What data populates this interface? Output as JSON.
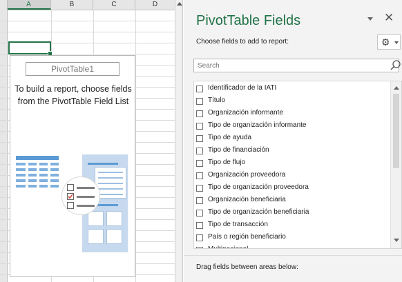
{
  "sheet": {
    "columns": [
      "A",
      "B",
      "C",
      "D"
    ],
    "pivot": {
      "name": "PivotTable1",
      "instructions": "To build a report, choose fields from the PivotTable Field List"
    }
  },
  "pane": {
    "title": "PivotTable Fields",
    "choose_label": "Choose fields to add to report:",
    "search_placeholder": "Search",
    "fields": [
      "Identificador de la IATI",
      "Título",
      "Organización informante",
      "Tipo de organización informante",
      "Tipo de ayuda",
      "Tipo de financiación",
      "Tipo de flujo",
      "Organización proveedora",
      "Tipo de organización proveedora",
      "Organización beneficiaria",
      "Tipo de organización beneficiaria",
      "Tipo de transacción",
      "País o región beneficiario",
      "Multinacional"
    ],
    "drag_label": "Drag fields between areas below:"
  },
  "icons": {
    "close": "close-icon",
    "gear": "gear-icon",
    "search": "search-icon",
    "caret": "chevron-down-icon"
  },
  "colors": {
    "accent": "#217346",
    "pane_bg": "#f3f3f3",
    "illustration": "#c7d9ee"
  }
}
